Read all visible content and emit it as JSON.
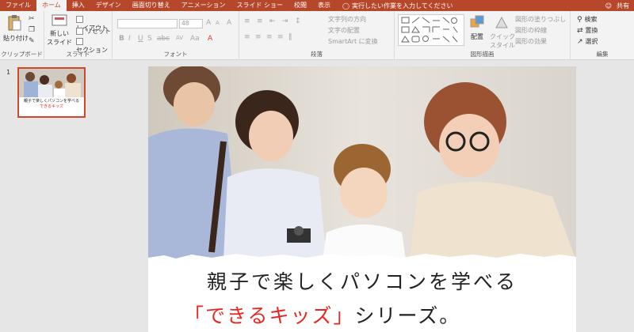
{
  "tabs": [
    "ファイル",
    "ホーム",
    "挿入",
    "デザイン",
    "画面切り替え",
    "アニメーション",
    "スライド ショー",
    "校閲",
    "表示"
  ],
  "tell_me": "実行したい作業を入力してください",
  "share_label": "共有",
  "ribbon": {
    "clipboard": {
      "paste": "貼り付け",
      "group": "クリップボード"
    },
    "slides": {
      "new_slide_line1": "新しい",
      "new_slide_line2": "スライド",
      "layout": "レイアウト",
      "reset": "リセット",
      "section": "セクション",
      "group": "スライド"
    },
    "font": {
      "size_value": "48",
      "group": "フォント",
      "aa": "AV"
    },
    "paragraph": {
      "text_direction": "文字列の方向",
      "align_text": "文字の配置",
      "smartart": "SmartArt に変換",
      "group": "段落"
    },
    "drawing": {
      "arrange": "配置",
      "quick_styles_line1": "クイック",
      "quick_styles_line2": "スタイル",
      "shape_fill": "図形の塗りつぶし",
      "shape_outline": "図形の枠線",
      "shape_effects": "図形の効果",
      "group": "図形描画"
    },
    "editing": {
      "find": "検索",
      "replace": "置換",
      "select": "選択",
      "group": "編集"
    }
  },
  "slide_number": "1",
  "slide": {
    "caption_line1": "親子で楽しくパソコンを学べる",
    "caption_bracket_open": "「",
    "caption_title": "できるキッズ",
    "caption_bracket_close": "」",
    "caption_suffix": "シリーズ。"
  },
  "colors": {
    "accent": "#b7472a",
    "caption_red": "#e8261f"
  }
}
